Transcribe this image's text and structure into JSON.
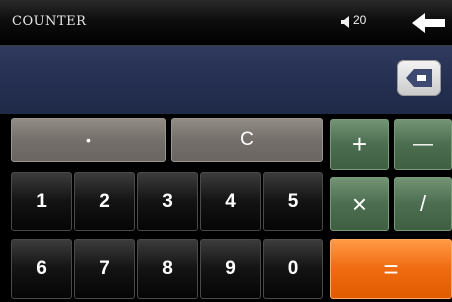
{
  "app": {
    "title": "COUNTER"
  },
  "status": {
    "volume_level": "20"
  },
  "display": {
    "value": ""
  },
  "keys": {
    "dot": "•",
    "clear": "C",
    "plus": "+",
    "minus": "—",
    "multiply": "×",
    "divide": "/",
    "equals": "=",
    "digits_row1": [
      "1",
      "2",
      "3",
      "4",
      "5"
    ],
    "digits_row2": [
      "6",
      "7",
      "8",
      "9",
      "0"
    ]
  },
  "colors": {
    "accent_orange": "#f06a10",
    "operator_green": "#4d6e50",
    "function_gray": "#75706b",
    "display_blue": "#253052"
  },
  "icons": {
    "volume": "speaker-icon",
    "back": "back-arrow-icon",
    "backspace": "backspace-icon"
  }
}
